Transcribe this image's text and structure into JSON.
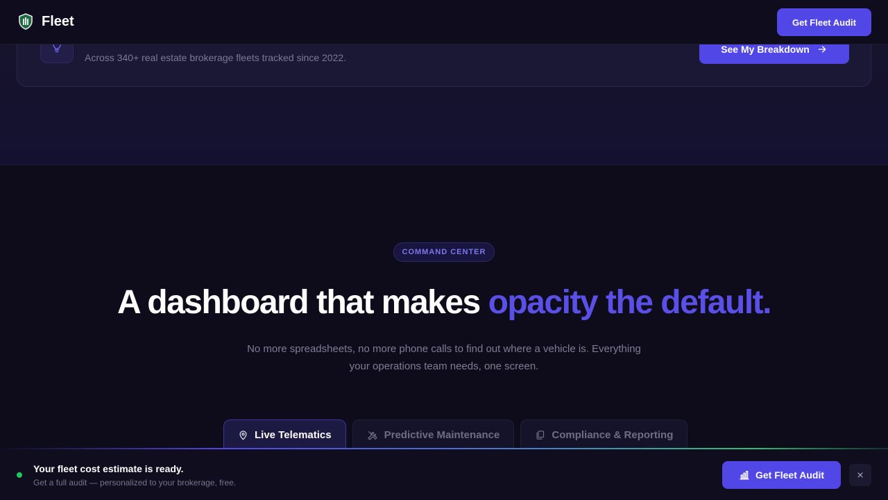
{
  "nav": {
    "brand": "Fleet",
    "cta_label": "Get Fleet Audit"
  },
  "savings_card": {
    "subtitle": "Across 340+ real estate brokerage fleets tracked since 2022.",
    "cta_label": "See My Breakdown"
  },
  "hero": {
    "badge": "COMMAND CENTER",
    "headline_plain": "A dashboard that makes ",
    "headline_accent": "opacity the default.",
    "subtext": "No more spreadsheets, no more phone calls to find out where a vehicle is. Everything your operations team needs, one screen."
  },
  "tabs": [
    {
      "label": "Live Telematics",
      "icon": "map-pin-icon",
      "active": true
    },
    {
      "label": "Predictive Maintenance",
      "icon": "wrench-icon",
      "active": false
    },
    {
      "label": "Compliance & Reporting",
      "icon": "documents-icon",
      "active": false
    }
  ],
  "bottom_bar": {
    "title": "Your fleet cost estimate is ready.",
    "subtitle": "Get a full audit — personalized to your brokerage, free.",
    "cta_label": "Get Fleet Audit",
    "cta_icon": "bar-chart-icon",
    "close_icon": "close-icon"
  },
  "colors": {
    "accent": "#5146e6",
    "accent_text": "#5a4fe6",
    "background": "#0e0c1b",
    "status": "#22c55e"
  }
}
